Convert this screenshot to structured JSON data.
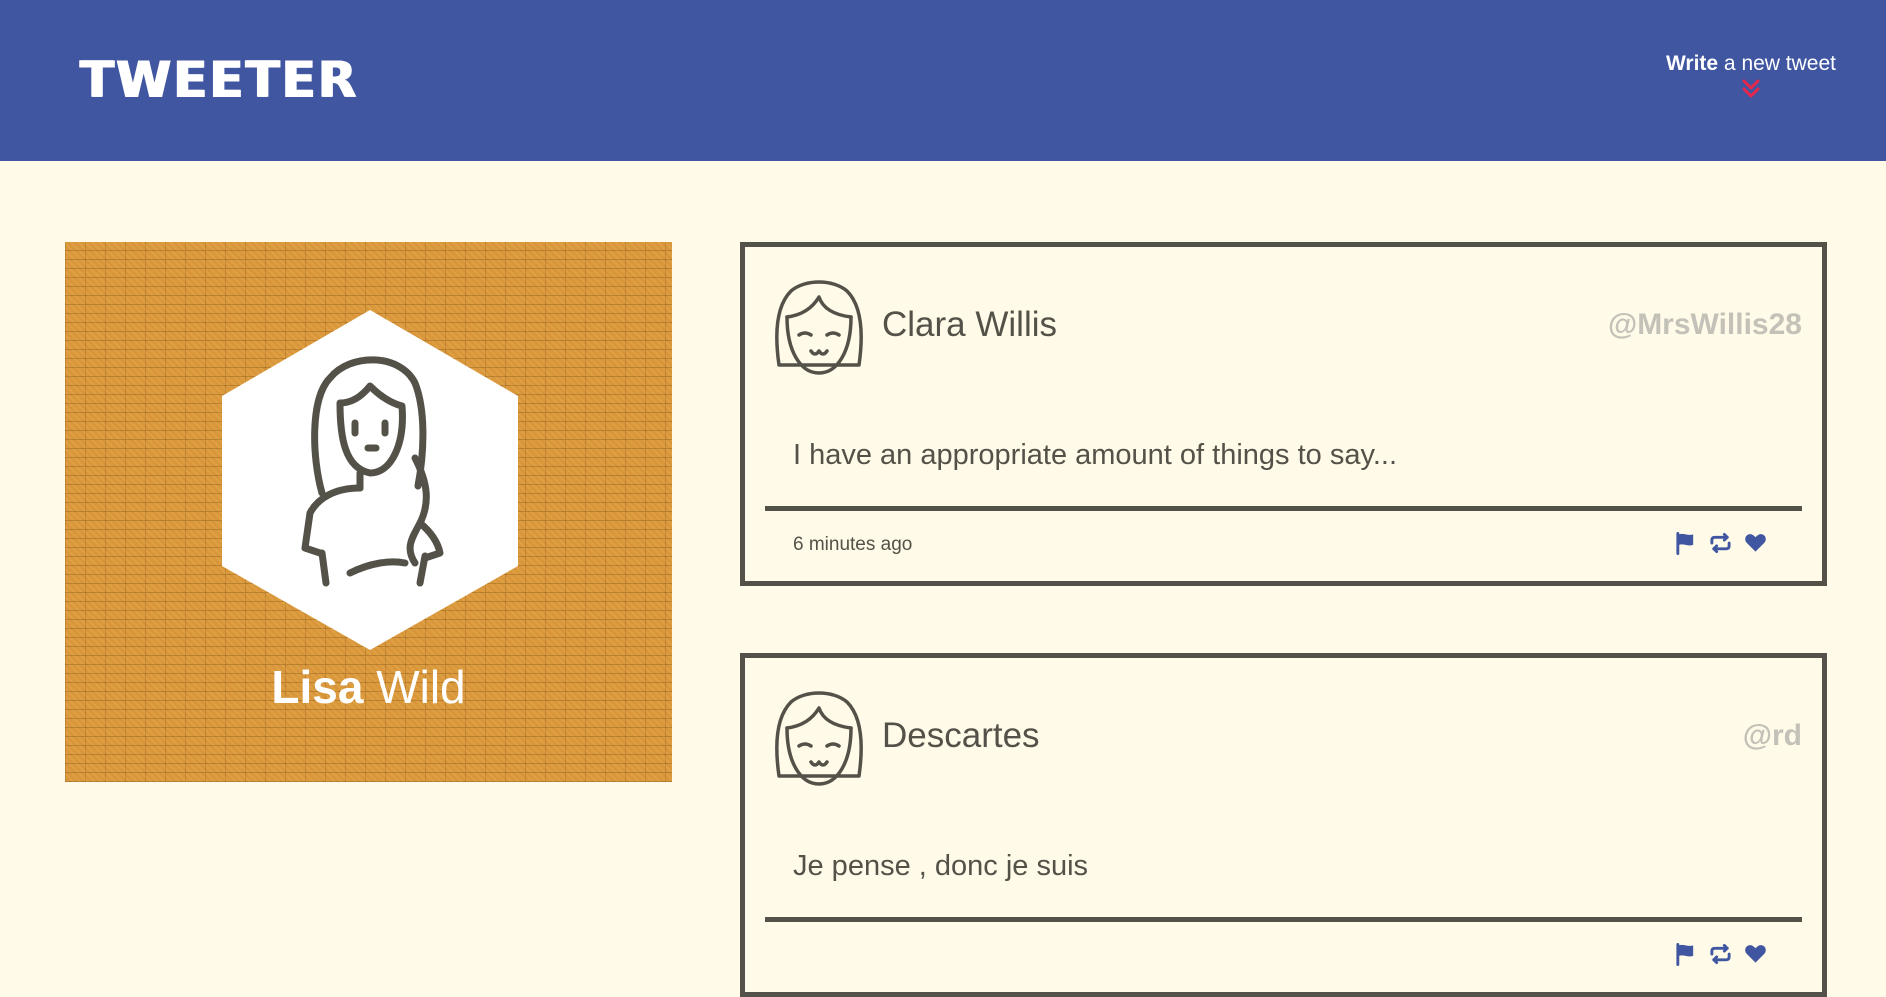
{
  "nav": {
    "logo": "TWEETER",
    "write_bold": "Write",
    "write_rest": " a new tweet",
    "chevron_icon": "double-chevron-down-icon",
    "chevron_color": "#e8264c"
  },
  "profile": {
    "first_name": "Lisa",
    "last_name": "Wild",
    "avatar_icon": "woman-avatar-icon",
    "background": "brick-wall-orange"
  },
  "tweets": [
    {
      "name": "Clara Willis",
      "handle": "@MrsWillis28",
      "text": "I have an appropriate amount of things to say...",
      "time": "6 minutes ago",
      "avatar_icon": "smiling-girl-avatar-icon"
    },
    {
      "name": "Descartes",
      "handle": "@rd",
      "text": "Je pense , donc je suis",
      "time": "",
      "avatar_icon": "smiling-girl-avatar-icon"
    }
  ],
  "action_icons": [
    "flag-icon",
    "retweet-icon",
    "heart-icon"
  ],
  "colors": {
    "nav_bg": "#4056a1",
    "page_bg": "#fffbe8",
    "text": "#545149",
    "handle": "#c4c2b8",
    "accent_blue": "#4056a1",
    "profile_bg": "#d9963a"
  }
}
